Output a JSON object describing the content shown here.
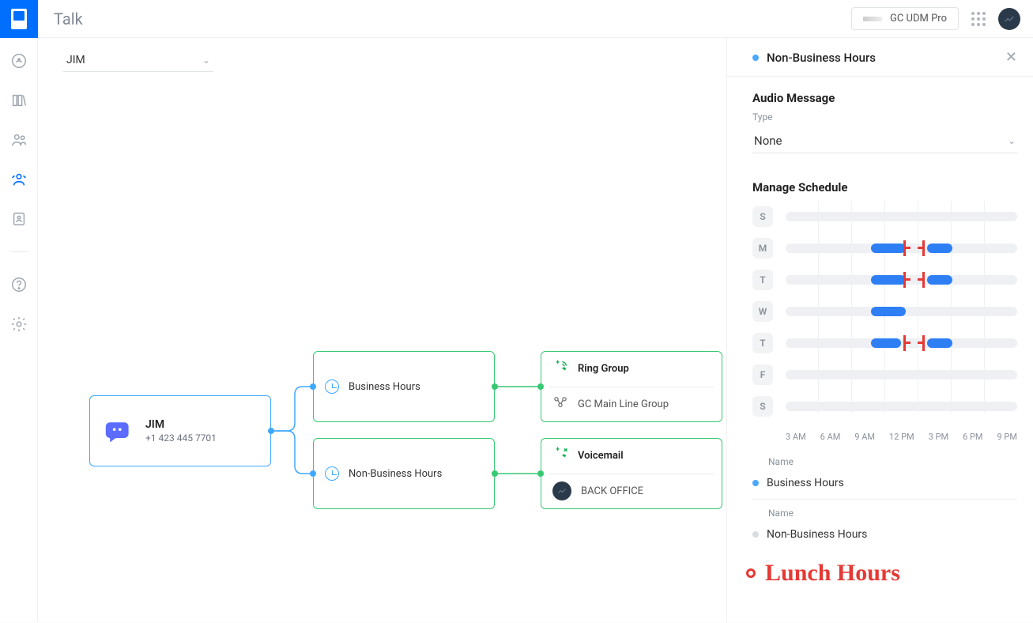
{
  "header": {
    "app_title": "Talk",
    "device_label": "GC UDM Pro"
  },
  "selector": {
    "value": "JIM"
  },
  "flow": {
    "root": {
      "title": "JIM",
      "phone": "+1 423 445 7701"
    },
    "business_hours": {
      "label": "Business Hours"
    },
    "non_business_hours": {
      "label": "Non-Business Hours"
    },
    "bh_leaf": {
      "title": "Ring Group",
      "group": "GC Main Line Group"
    },
    "nbh_leaf": {
      "title": "Voicemail",
      "target": "BACK OFFICE"
    }
  },
  "panel": {
    "title": "Non-Business Hours",
    "audio_section": "Audio Message",
    "type_label": "Type",
    "type_value": "None",
    "schedule_section": "Manage Schedule",
    "days": [
      "S",
      "M",
      "T",
      "W",
      "T",
      "F",
      "S"
    ],
    "segments": {
      "S0": [],
      "M": [
        {
          "start": 37,
          "end": 52
        },
        {
          "start": 61,
          "end": 72
        }
      ],
      "T1": [
        {
          "start": 37,
          "end": 52
        },
        {
          "start": 61,
          "end": 72
        }
      ],
      "W": [
        {
          "start": 37,
          "end": 52
        }
      ],
      "T2": [
        {
          "start": 37,
          "end": 50
        },
        {
          "start": 61,
          "end": 72
        }
      ],
      "F": [],
      "S1": []
    },
    "red_marks": {
      "M": true,
      "T1": true,
      "T2": true
    },
    "time_labels": [
      "3 AM",
      "6 AM",
      "9 AM",
      "12 PM",
      "3 PM",
      "6 PM",
      "9 PM"
    ],
    "legend": {
      "name_label": "Name",
      "bh": "Business Hours",
      "nbh": "Non-Business Hours"
    },
    "handwritten": "Lunch Hours"
  }
}
